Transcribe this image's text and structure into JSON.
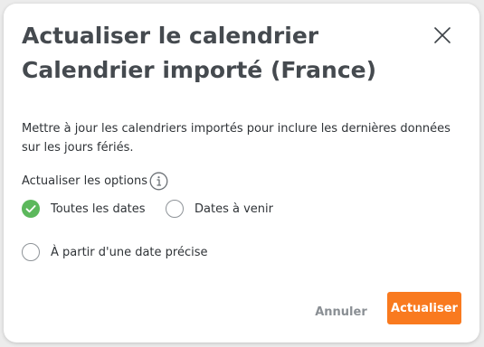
{
  "dialog": {
    "title_line1": "Actualiser le calendrier",
    "title_line2": "Calendrier importé (France)",
    "close_icon": "close-icon",
    "description": "Mettre à jour les calendriers importés pour inclure les dernières données sur les jours fériés.",
    "options_label": "Actualiser les options",
    "info_icon": "info-icon",
    "options": [
      {
        "label": "Toutes les dates",
        "selected": true
      },
      {
        "label": "Dates à venir",
        "selected": false
      },
      {
        "label": "À partir d'une date précise",
        "selected": false
      }
    ],
    "cancel_label": "Annuler",
    "confirm_label": "Actualiser"
  },
  "colors": {
    "accent": "#f97a1f",
    "selected": "#5cb85c",
    "title": "#454a4f"
  }
}
